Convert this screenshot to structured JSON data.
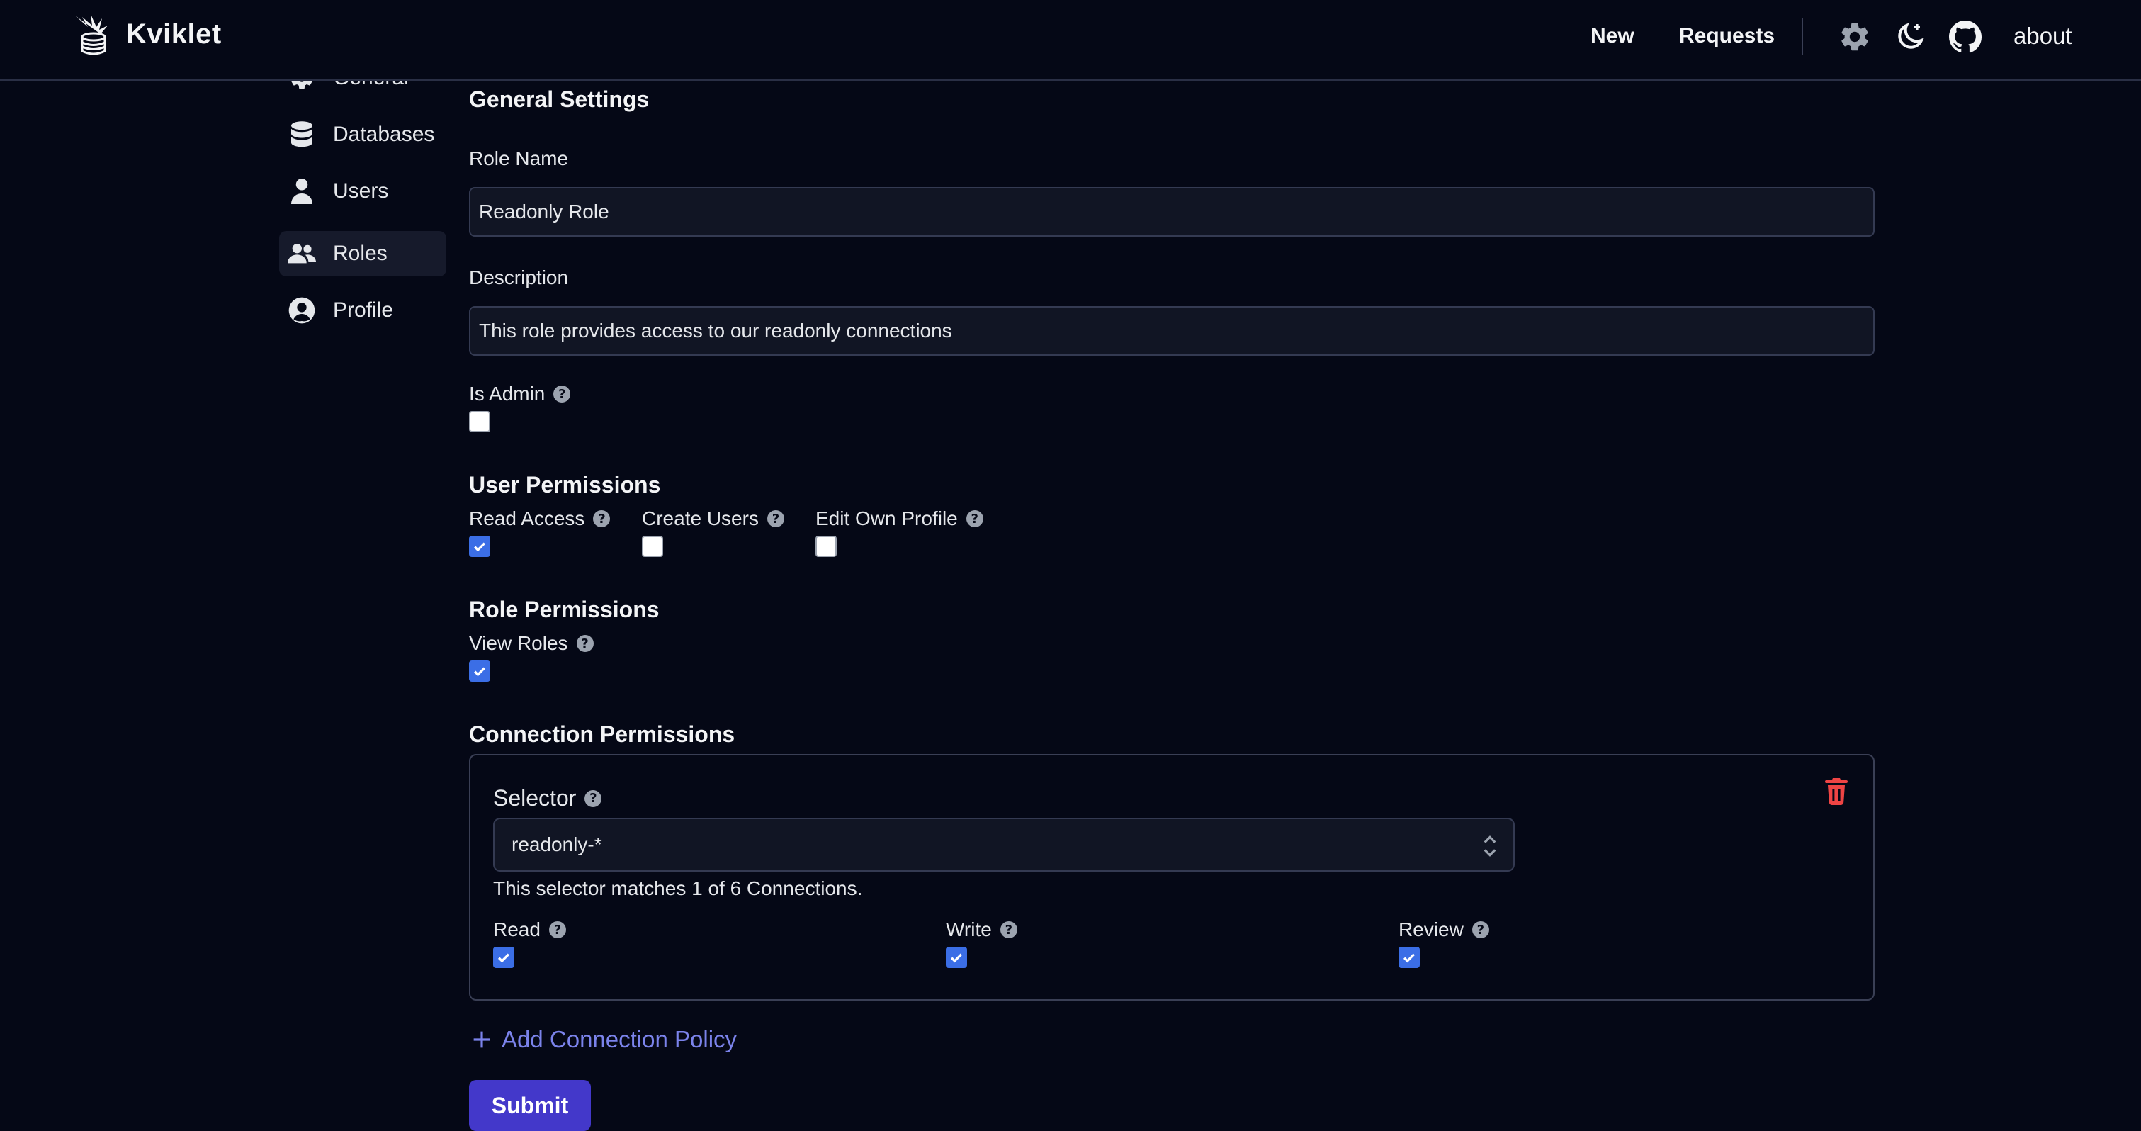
{
  "app": {
    "name": "Kviklet"
  },
  "header": {
    "nav": [
      "New",
      "Requests"
    ],
    "icons": [
      "gear-icon",
      "moon-icon",
      "github-icon"
    ],
    "about_label": "about"
  },
  "sidebar": {
    "items": [
      {
        "label": "General",
        "icon": "gear-icon",
        "active": false
      },
      {
        "label": "Databases",
        "icon": "database-icon",
        "active": false
      },
      {
        "label": "Users",
        "icon": "user-icon",
        "active": false
      },
      {
        "label": "Roles",
        "icon": "users-icon",
        "active": true
      },
      {
        "label": "Profile",
        "icon": "user-circle-icon",
        "active": false
      }
    ]
  },
  "form": {
    "section_title": "General Settings",
    "role_name": {
      "label": "Role Name",
      "value": "Readonly Role"
    },
    "description": {
      "label": "Description",
      "value": "This role provides access to our readonly connections"
    },
    "is_admin": {
      "label": "Is Admin",
      "checked": false
    },
    "user_permissions": {
      "title": "User Permissions",
      "items": [
        {
          "label": "Read Access",
          "checked": true
        },
        {
          "label": "Create Users",
          "checked": false
        },
        {
          "label": "Edit Own Profile",
          "checked": false
        }
      ]
    },
    "role_permissions": {
      "title": "Role Permissions",
      "items": [
        {
          "label": "View Roles",
          "checked": true
        }
      ]
    },
    "connection_permissions": {
      "title": "Connection Permissions",
      "policy": {
        "selector_label": "Selector",
        "selector_value": "readonly-*",
        "match_text": "This selector matches 1 of 6 Connections.",
        "permissions": [
          {
            "label": "Read",
            "checked": true
          },
          {
            "label": "Write",
            "checked": true
          },
          {
            "label": "Review",
            "checked": true
          }
        ]
      },
      "add_label": "Add Connection Policy"
    },
    "submit_label": "Submit"
  },
  "colors": {
    "background": "#050816",
    "accent": "#4338ca",
    "checkbox_checked": "#3b6ee6",
    "link": "#7b83eb",
    "danger": "#ef4444"
  }
}
